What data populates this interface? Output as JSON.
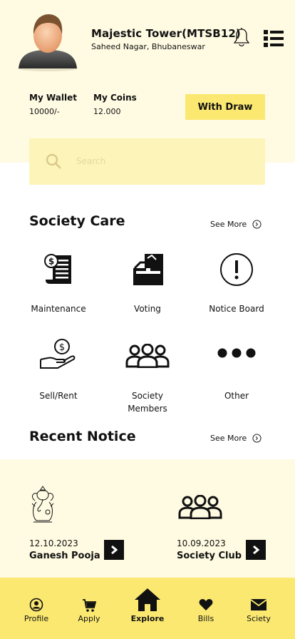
{
  "header": {
    "building_name": "Majestic Tower(MTSB12)",
    "location": "Saheed Nagar, Bhubaneswar",
    "avatar_icon": "user-avatar-icon",
    "notification_icon": "bell-icon",
    "menu_icon": "list-menu-icon"
  },
  "wallet": {
    "wallet_label": "My Wallet",
    "wallet_value": "10000/-",
    "coins_label": "My Coins",
    "coins_value": "12.000",
    "withdraw_label": "With Draw"
  },
  "search": {
    "placeholder": "Search",
    "icon": "search-icon"
  },
  "society_care": {
    "title": "Society Care",
    "see_more": "See More",
    "items": [
      {
        "label": "Maintenance",
        "icon": "receipt-icon"
      },
      {
        "label": "Voting",
        "icon": "ballot-box-icon"
      },
      {
        "label": "Notice Board",
        "icon": "exclamation-icon"
      },
      {
        "label": "Sell/Rent",
        "icon": "hand-coin-icon"
      },
      {
        "label": "Society\nMembers",
        "icon": "group-icon"
      },
      {
        "label": "Other",
        "icon": "more-dots-icon"
      }
    ]
  },
  "recent_notice": {
    "title": "Recent Notice",
    "see_more": "See More",
    "cards": [
      {
        "date": "12.10.2023",
        "title": "Ganesh Pooja",
        "icon": "ganesha-icon"
      },
      {
        "date": "10.09.2023",
        "title": "Society Club",
        "icon": "group-icon"
      }
    ]
  },
  "bottom_nav": {
    "items": [
      {
        "label": "Profile",
        "icon": "profile-icon",
        "active": false
      },
      {
        "label": "Apply",
        "icon": "cart-icon",
        "active": false
      },
      {
        "label": "Explore",
        "icon": "home-icon",
        "active": true
      },
      {
        "label": "Bills",
        "icon": "heart-icon",
        "active": false
      },
      {
        "label": "Sciety",
        "icon": "mail-icon",
        "active": false
      }
    ]
  },
  "colors": {
    "band_background": "#fffbe2",
    "accent_yellow": "#fbe871",
    "search_background": "#fdf4b9",
    "text": "#111111"
  }
}
